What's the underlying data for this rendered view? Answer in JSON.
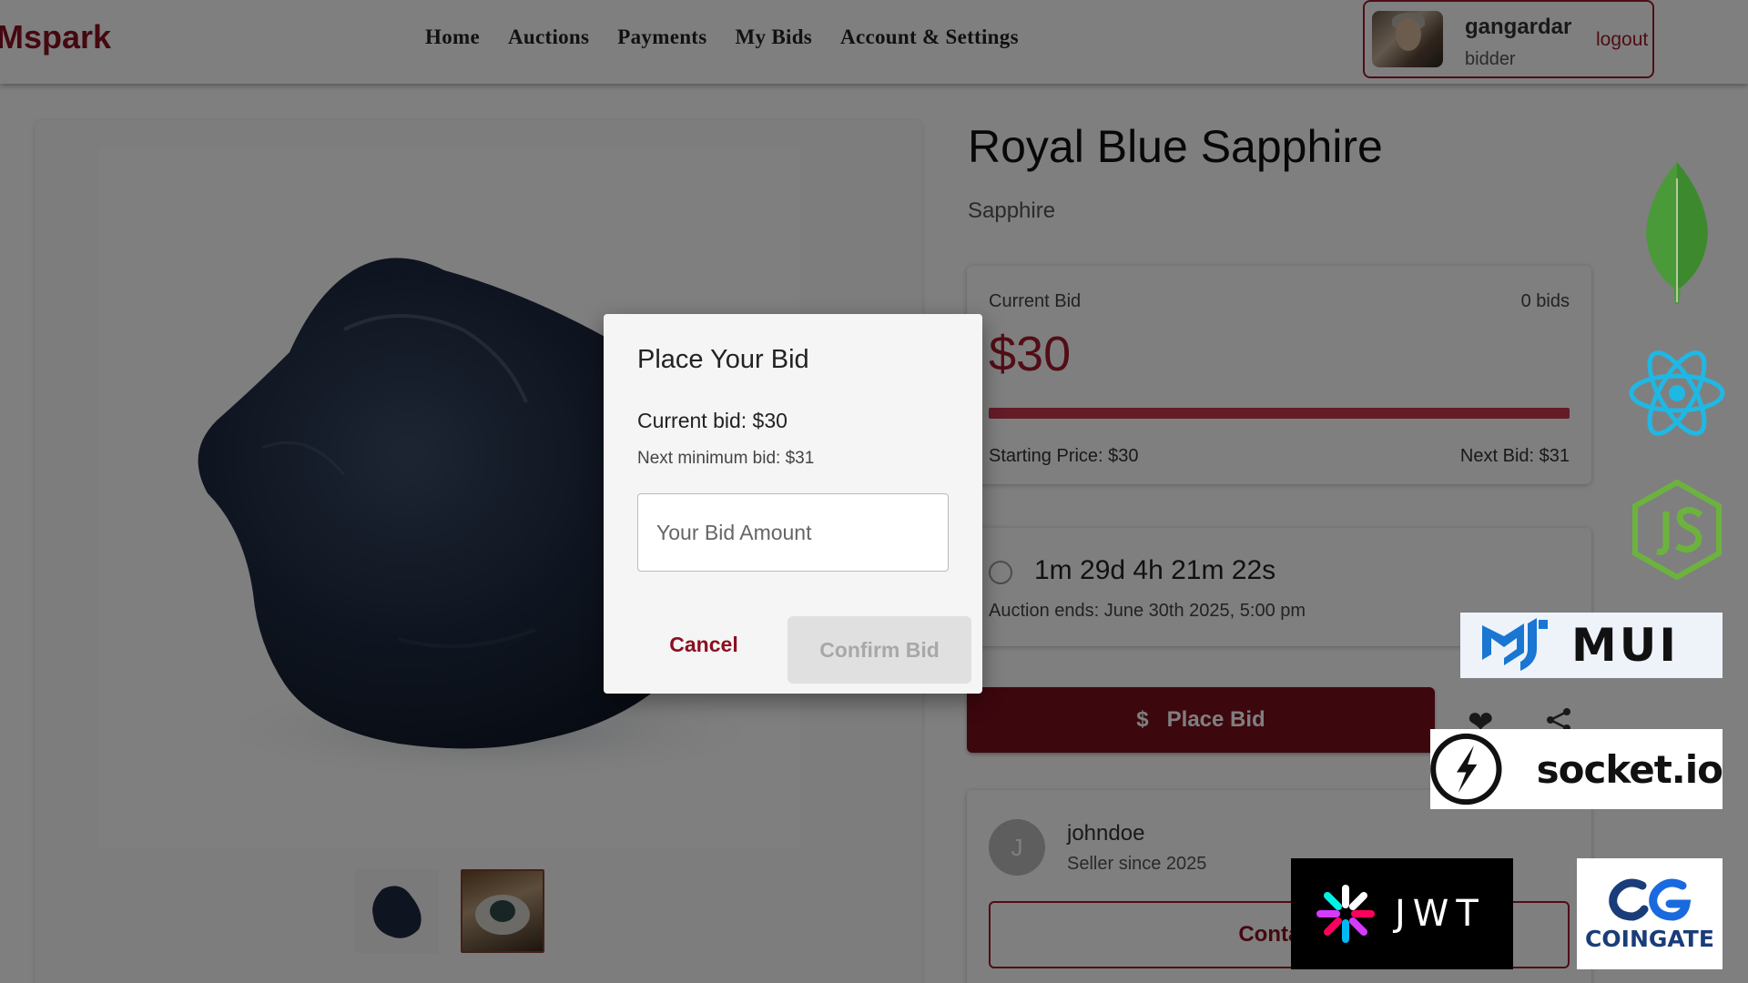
{
  "header": {
    "brand": "Mspark",
    "nav": [
      "Home",
      "Auctions",
      "Payments",
      "My Bids",
      "Account & Settings"
    ],
    "user": {
      "name": "gangardar",
      "role": "bidder",
      "logout_label": "logout"
    }
  },
  "product": {
    "title": "Royal Blue Sapphire",
    "category": "Sapphire",
    "current_bid_label": "Current Bid",
    "bid_count": "0 bids",
    "current_bid": "$30",
    "progress_fraction": 1.0,
    "starting_price": "Starting Price: $30",
    "next_bid": "Next Bid: $31",
    "time_left": "1m 29d 4h 21m 22s",
    "auction_ends": "Auction ends: June 30th 2025, 5:00 pm",
    "place_bid_label": "Place Bid",
    "place_bid_icon": "$"
  },
  "seller": {
    "initial": "J",
    "name": "johndoe",
    "since": "Seller since 2025",
    "contact_label": "Contact"
  },
  "dialog": {
    "title": "Place Your Bid",
    "current_bid": "Current bid: $30",
    "min_bid": "Next minimum bid: $31",
    "input_placeholder": "Your Bid Amount",
    "cancel_label": "Cancel",
    "confirm_label": "Confirm Bid"
  },
  "tech_logos": {
    "mui": "MUI",
    "socket": "socket.io",
    "jwt": "JWT",
    "coingate": "COINGATE"
  },
  "colors": {
    "brand": "#8b1020",
    "accent": "#a51a2c",
    "button": "#7a0e1c"
  }
}
